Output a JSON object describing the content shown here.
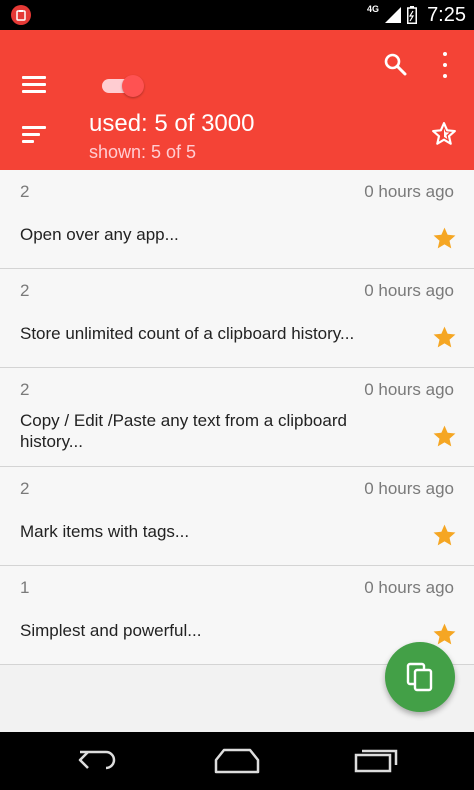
{
  "status_bar": {
    "network": "4G",
    "time": "7:25"
  },
  "app_bar": {
    "used_text": "used: 5 of 3000",
    "shown_text": "shown: 5 of 5",
    "toggle_on": true,
    "accent_color": "#f44336"
  },
  "items": [
    {
      "count": "2",
      "time": "0 hours ago",
      "text": "Open over any app...",
      "starred": true
    },
    {
      "count": "2",
      "time": "0 hours ago",
      "text": "Store unlimited count of a clipboard history...",
      "starred": true
    },
    {
      "count": "2",
      "time": "0 hours ago",
      "text": "Copy / Edit /Paste any text from a clipboard history...",
      "starred": true
    },
    {
      "count": "2",
      "time": "0 hours ago",
      "text": "Mark items with tags...",
      "starred": true
    },
    {
      "count": "1",
      "time": "0 hours ago",
      "text": "Simplest and powerful...",
      "starred": true
    }
  ],
  "icons": {
    "menu": "menu-icon",
    "search": "search-icon",
    "more": "more-vert-icon",
    "sort": "sort-icon",
    "star_outline": "star-outline-icon",
    "star": "star-icon",
    "fab": "copy-icon"
  },
  "colors": {
    "star": "#f5a623",
    "fab": "#43a047"
  }
}
